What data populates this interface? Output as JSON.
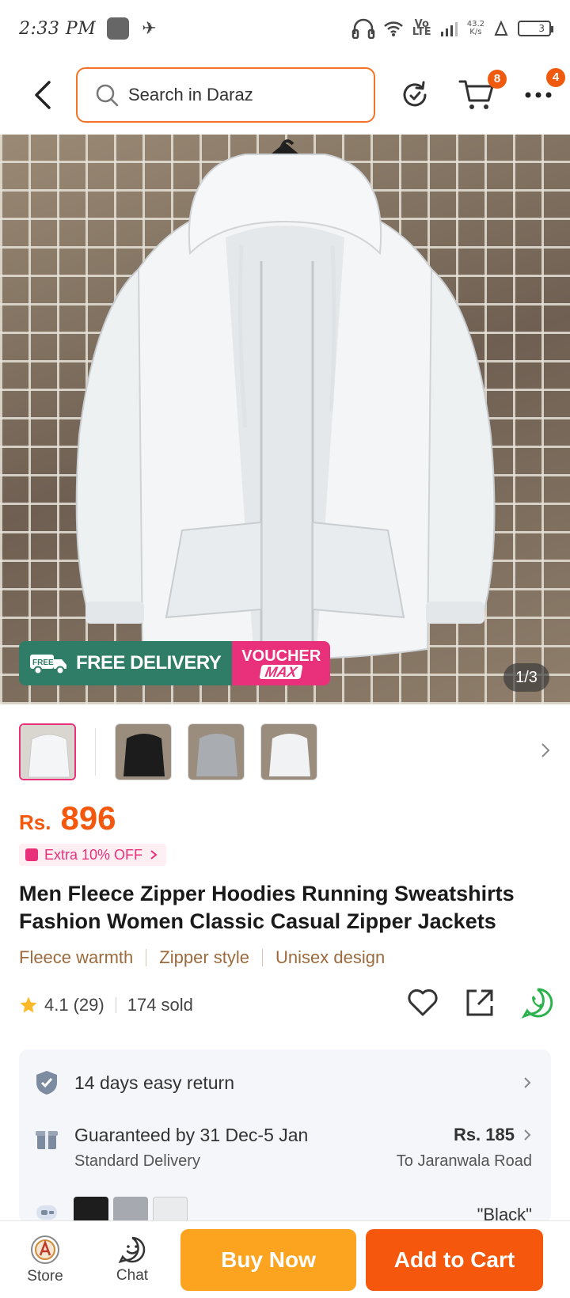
{
  "status_bar": {
    "time": "2:33 PM",
    "network": "Vo LTE",
    "speed_top": "43.2",
    "speed_bottom": "K/s",
    "battery": "3"
  },
  "nav": {
    "search_placeholder": "Search in Daraz",
    "cart_count": "8",
    "more_count": "4"
  },
  "hero": {
    "free_label": "FREE",
    "free_delivery": "FREE DELIVERY",
    "voucher_top": "VOUCHER",
    "voucher_bottom": "MAX",
    "counter": "1/3"
  },
  "thumbnails": [
    {
      "color": "white",
      "active": true
    },
    {
      "color": "black",
      "active": false
    },
    {
      "color": "gray",
      "active": false
    },
    {
      "color": "white",
      "active": false
    }
  ],
  "product": {
    "currency": "Rs.",
    "price": "896",
    "extra_off": "Extra 10% OFF",
    "title": "Men Fleece Zipper Hoodies Running Sweatshirts Fashion Women Classic Casual Zipper Jackets",
    "features": [
      "Fleece warmth",
      "Zipper style",
      "Unisex design"
    ],
    "rating": "4.1",
    "reviews": "(29)",
    "sold": "174 sold"
  },
  "info": {
    "return_text": "14 days easy return",
    "delivery_main": "Guaranteed by 31 Dec-5 Jan",
    "delivery_sub": "Standard Delivery",
    "delivery_fee": "Rs. 185",
    "delivery_to": "To Jaranwala Road",
    "variant_selected": "\"Black\""
  },
  "bottom_bar": {
    "store_label": "Store",
    "chat_label": "Chat",
    "buy_now": "Buy Now",
    "add_to_cart": "Add to Cart"
  },
  "colors": {
    "accent": "#f57224",
    "price": "#f5570c",
    "buy_now": "#fca31f",
    "add_to_cart": "#f5570c",
    "pink": "#e9317b",
    "free_delivery_green": "#2f7d66"
  }
}
